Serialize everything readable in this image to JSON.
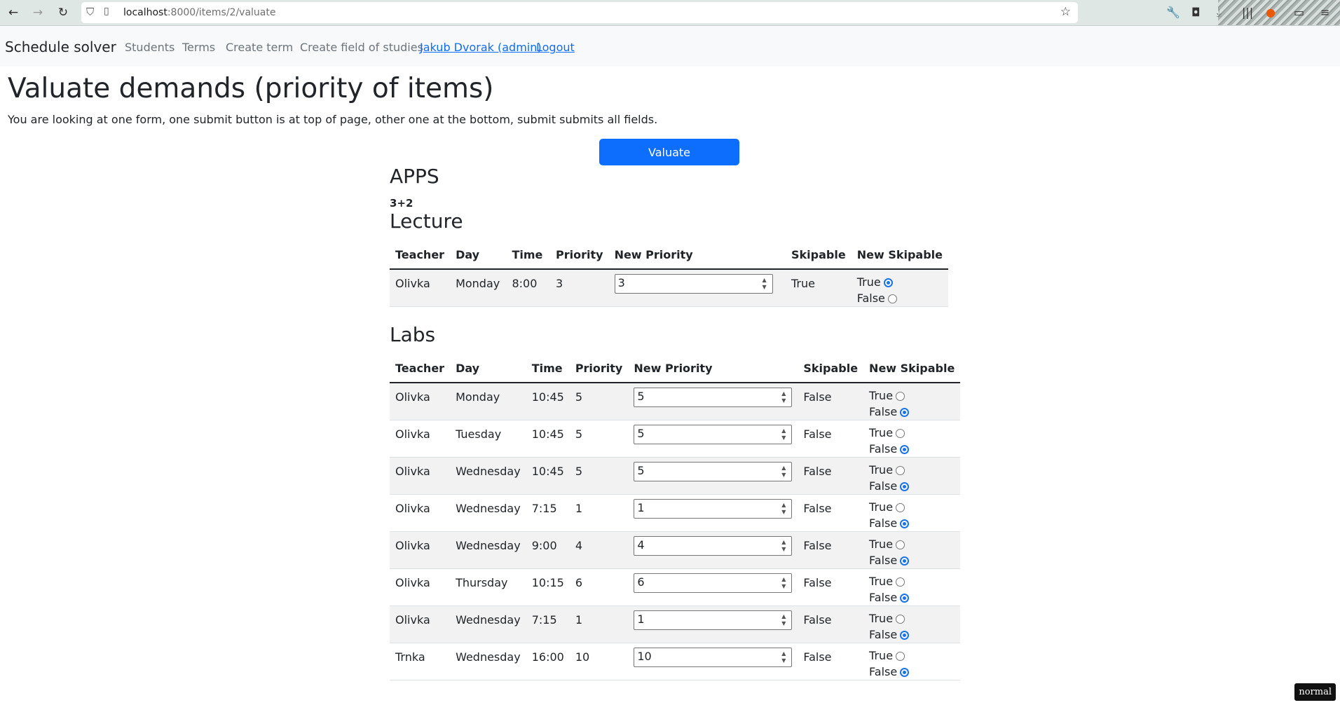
{
  "browser": {
    "url_host": "localhost",
    "url_path": ":8000/items/2/valuate"
  },
  "nav": {
    "brand": "Schedule solver",
    "links": [
      "Students",
      "Terms",
      "Create term",
      "Create field of studies"
    ],
    "user": "Jakub Dvorak (admin)",
    "logout": "Logout"
  },
  "page": {
    "title": "Valuate demands (priority of items)",
    "intro": "You are looking at one form, one submit button is at top of page, other one at the bottom, submit submits all fields.",
    "submit_label": "Valuate",
    "subject": "APPS",
    "code": "3+2"
  },
  "columns": {
    "teacher": "Teacher",
    "day": "Day",
    "time": "Time",
    "priority": "Priority",
    "new_priority": "New Priority",
    "skipable": "Skipable",
    "new_skipable": "New Skipable"
  },
  "radio_labels": {
    "true": "True",
    "false": "False"
  },
  "lecture": {
    "title": "Lecture",
    "rows": [
      {
        "teacher": "Olivka",
        "day": "Monday",
        "time": "8:00",
        "priority": "3",
        "new_priority": "3",
        "skipable": "True",
        "new_skipable": true
      }
    ]
  },
  "labs": {
    "title": "Labs",
    "rows": [
      {
        "teacher": "Olivka",
        "day": "Monday",
        "time": "10:45",
        "priority": "5",
        "new_priority": "5",
        "skipable": "False",
        "new_skipable": false
      },
      {
        "teacher": "Olivka",
        "day": "Tuesday",
        "time": "10:45",
        "priority": "5",
        "new_priority": "5",
        "skipable": "False",
        "new_skipable": false
      },
      {
        "teacher": "Olivka",
        "day": "Wednesday",
        "time": "10:45",
        "priority": "5",
        "new_priority": "5",
        "skipable": "False",
        "new_skipable": false
      },
      {
        "teacher": "Olivka",
        "day": "Wednesday",
        "time": "7:15",
        "priority": "1",
        "new_priority": "1",
        "skipable": "False",
        "new_skipable": false
      },
      {
        "teacher": "Olivka",
        "day": "Wednesday",
        "time": "9:00",
        "priority": "4",
        "new_priority": "4",
        "skipable": "False",
        "new_skipable": false
      },
      {
        "teacher": "Olivka",
        "day": "Thursday",
        "time": "10:15",
        "priority": "6",
        "new_priority": "6",
        "skipable": "False",
        "new_skipable": false
      },
      {
        "teacher": "Olivka",
        "day": "Wednesday",
        "time": "7:15",
        "priority": "1",
        "new_priority": "1",
        "skipable": "False",
        "new_skipable": false
      },
      {
        "teacher": "Trnka",
        "day": "Wednesday",
        "time": "16:00",
        "priority": "10",
        "new_priority": "10",
        "skipable": "False",
        "new_skipable": false
      }
    ]
  },
  "mode_badge": "normal"
}
